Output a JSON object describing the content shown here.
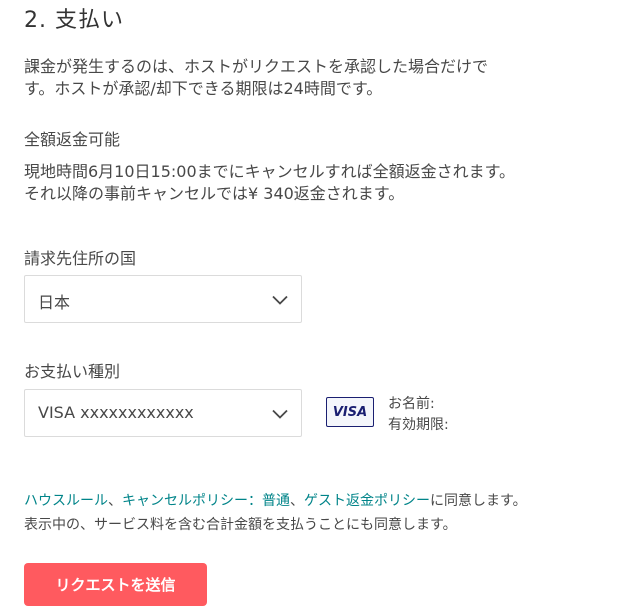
{
  "section": {
    "title": "2. 支払い"
  },
  "intro": {
    "line1": "課金が発生するのは、ホストがリクエストを承認した場合だけで",
    "line2": "す。ホストが承認/却下できる期限は24時間です。"
  },
  "refund": {
    "heading": "全額返金可能",
    "line1": "現地時間6月10日15:00までにキャンセルすれば全額返金されます。",
    "line2": "それ以降の事前キャンセルでは¥ 340返金されます。"
  },
  "billing_country": {
    "label": "請求先住所の国",
    "selected": "日本",
    "chevron_icon": "chevron-down"
  },
  "payment_type": {
    "label": "お支払い種別",
    "selected": "VISA xxxxxxxxxxxx",
    "chevron_icon": "chevron-down",
    "card_brand": "VISA",
    "name_label": "お名前:",
    "expiry_label": "有効期限:"
  },
  "policy": {
    "house_rules": "ハウスルール",
    "sep1": "、",
    "cancellation_policy": "キャンセルポリシー：普通",
    "sep2": "、",
    "guest_refund_policy": "ゲスト返金ポリシー",
    "agree_suffix": "に同意します。",
    "line2": "表示中の、サービス料を含む合計金額を支払うことにも同意します。"
  },
  "submit": {
    "label": "リクエストを送信"
  },
  "colors": {
    "link": "#008489",
    "primary_button": "#ff5a5f",
    "visa": "#1a1f71"
  }
}
